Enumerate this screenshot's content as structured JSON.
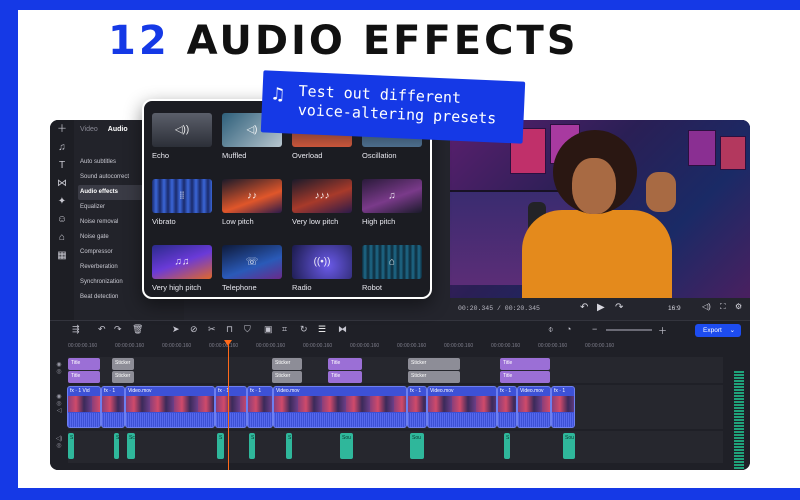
{
  "headline": {
    "number": "12",
    "text": "AUDIO EFFECTS"
  },
  "promo": {
    "line1": "Test out different",
    "line2": "voice-altering presets"
  },
  "sidebar": {
    "tabs": [
      "Video",
      "Audio"
    ],
    "items": [
      "Auto subtitles",
      "Sound autocorrect",
      "Audio effects",
      "Equalizer",
      "Noise removal",
      "Noise gate",
      "Compressor",
      "Reverberation",
      "Synchronization",
      "Beat detection"
    ]
  },
  "effects": [
    "Echo",
    "Muffled",
    "Overload",
    "Oscillation",
    "Vibrato",
    "Low pitch",
    "Very low pitch",
    "High pitch",
    "Very high pitch",
    "Telephone",
    "Radio",
    "Robot"
  ],
  "player": {
    "time": "00:20.345 / 00:20.345",
    "zoom": "16:9"
  },
  "timeline": {
    "export_label": "Export",
    "ruler": [
      "00:00:00.160",
      "00:00:00.160",
      "00:00:00.160",
      "00:00:00.160",
      "00:00:00.160",
      "00:00:00.160",
      "00:00:00.160",
      "00:00:00.160",
      "00:00:00.160",
      "00:00:00.160",
      "00:00:00.160",
      "00:00:00.160"
    ],
    "title_clips": [
      "Title",
      "Sticker",
      "Sticker",
      "Title",
      "Sticker",
      "Title"
    ],
    "title_clips_row2": [
      "Title",
      "Sticker",
      "Sticker",
      "Title",
      "Sticker",
      "Title"
    ],
    "video_clips": [
      "fx · 1  Vid",
      "fx · 1",
      "Video.mov",
      "fx · 1",
      "fx · 1",
      "Video.mov",
      "fx · 1",
      "Video.mov",
      "fx · 1",
      "Video.mov",
      "fx · 1"
    ],
    "audio_clips": [
      "S",
      "S",
      "Sc",
      "S",
      "S",
      "S",
      "Sou",
      "Sou",
      "S",
      "Sou"
    ]
  },
  "colors": {
    "brand": "#1539e6",
    "accent_orange": "#ff6a1a",
    "audio_clip": "#2fb79b",
    "video_clip": "#3d51d6"
  }
}
